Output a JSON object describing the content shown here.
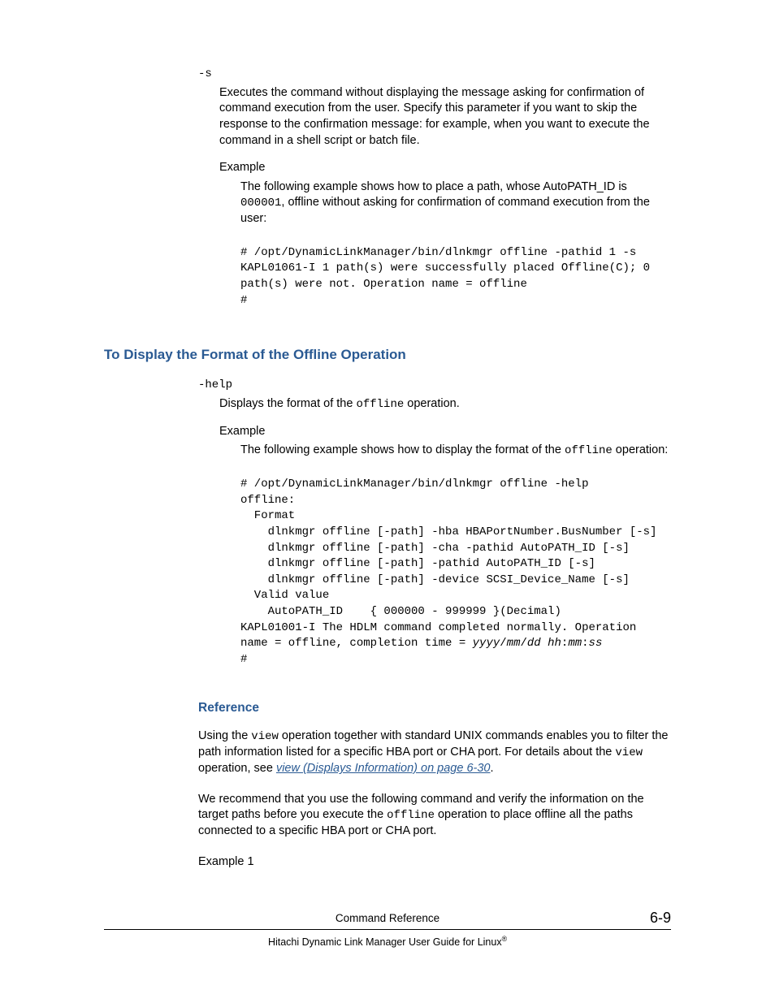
{
  "section1": {
    "opt_name": "-s",
    "opt_desc": "Executes the command without displaying the message asking for confirmation of command execution from the user. Specify this parameter if you want to skip the response to the confirmation message: for example, when you want to execute the command in a shell script or batch file.",
    "example_label": "Example",
    "example_desc_1": "The following example shows how to place a path, whose AutoPATH_ID is ",
    "example_desc_code": "000001",
    "example_desc_2": ", offline without asking for confirmation of command execution from the user:",
    "code": "# /opt/DynamicLinkManager/bin/dlnkmgr offline -pathid 1 -s\nKAPL01061-I 1 path(s) were successfully placed Offline(C); 0\npath(s) were not. Operation name = offline\n#"
  },
  "heading1": "To Display the Format of the Offline Operation",
  "section2": {
    "opt_name": "-help",
    "opt_desc_1": "Displays the format of the ",
    "opt_desc_code": "offline",
    "opt_desc_2": " operation.",
    "example_label": "Example",
    "example_desc_1": "The following example shows how to display the format of the ",
    "example_desc_code": "offline",
    "example_desc_2": " operation:",
    "code_plain": "# /opt/DynamicLinkManager/bin/dlnkmgr offline -help\noffline:\n  Format\n    dlnkmgr offline [-path] -hba HBAPortNumber.BusNumber [-s]\n    dlnkmgr offline [-path] -cha -pathid AutoPATH_ID [-s]\n    dlnkmgr offline [-path] -pathid AutoPATH_ID [-s]\n    dlnkmgr offline [-path] -device SCSI_Device_Name [-s]\n  Valid value\n    AutoPATH_ID    { 000000 - 999999 }(Decimal)\nKAPL01001-I The HDLM command completed normally. Operation\nname = offline, completion time = ",
    "code_ital": "yyyy",
    "code_sep1": "/",
    "code_ital2": "mm",
    "code_sep2": "/",
    "code_ital3": "dd",
    "code_sep3": " ",
    "code_ital4": "hh",
    "code_sep4": ":",
    "code_ital5": "mm",
    "code_sep5": ":",
    "code_ital6": "ss",
    "code_tail": "\n#"
  },
  "heading2": "Reference",
  "reference": {
    "p1_a": "Using the ",
    "p1_code1": "view",
    "p1_b": " operation together with standard UNIX commands enables you to filter the path information listed for a specific HBA port or CHA port. For details about the ",
    "p1_code2": "view",
    "p1_c": " operation, see ",
    "p1_link": "view (Displays Information) on page 6-30",
    "p1_d": ".",
    "p2_a": "We recommend that you use the following command and verify the information on the target paths before you execute the ",
    "p2_code": "offline",
    "p2_b": " operation to place offline all the paths connected to a specific HBA port or CHA port.",
    "p3": "Example 1"
  },
  "footer": {
    "title": "Command Reference",
    "page": "6-9",
    "book": "Hitachi Dynamic Link Manager User Guide for Linux"
  }
}
